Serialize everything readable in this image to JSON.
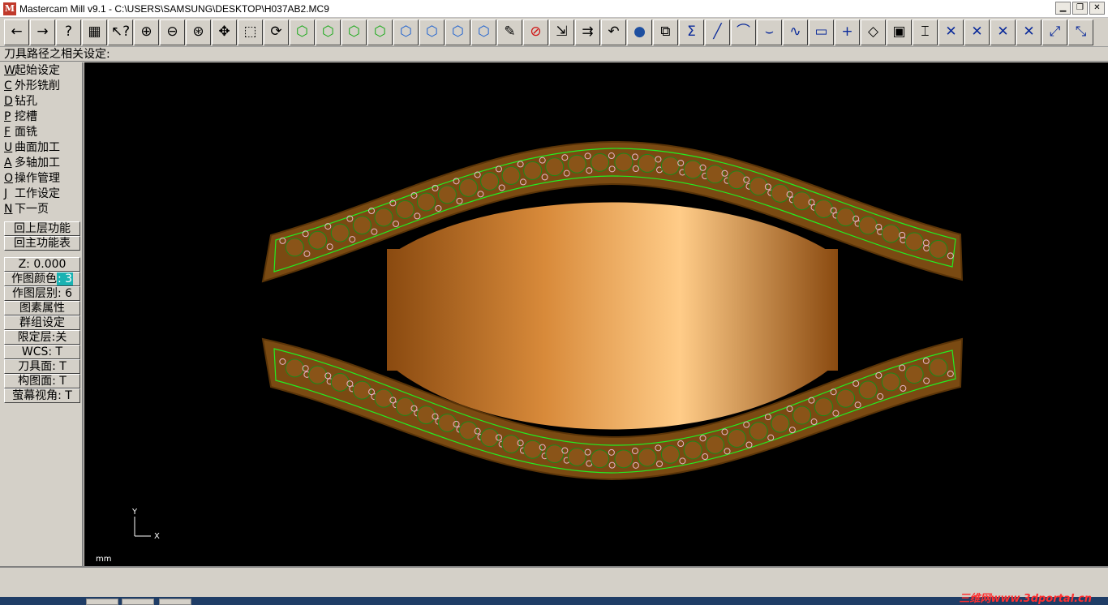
{
  "window": {
    "title": "Mastercam Mill v9.1 - C:\\USERS\\SAMSUNG\\DESKTOP\\H037AB2.MC9",
    "app_icon": "mastercam-logo-icon",
    "minimize_label": "▁",
    "restore_label": "❐",
    "close_label": "✕"
  },
  "toolbar": {
    "buttons": [
      {
        "name": "back-icon",
        "glyph": "←"
      },
      {
        "name": "forward-icon",
        "glyph": "→"
      },
      {
        "name": "help-icon",
        "glyph": "?"
      },
      {
        "name": "calculator-icon",
        "glyph": "▦"
      },
      {
        "name": "analyze-icon",
        "glyph": "↖?"
      },
      {
        "name": "zoom-window-icon",
        "glyph": "⊕"
      },
      {
        "name": "zoom-out-icon",
        "glyph": "⊖"
      },
      {
        "name": "zoom-fit-icon",
        "glyph": "⊛"
      },
      {
        "name": "pan-icon",
        "glyph": "✥"
      },
      {
        "name": "zoom-select-icon",
        "glyph": "⬚"
      },
      {
        "name": "dynamic-rotate-icon",
        "glyph": "⟳"
      },
      {
        "name": "view-top-cube-icon",
        "glyph": "⬡"
      },
      {
        "name": "view-front-cube-icon",
        "glyph": "⬡"
      },
      {
        "name": "view-side-cube-icon",
        "glyph": "⬡"
      },
      {
        "name": "view-iso-cube-icon",
        "glyph": "⬡"
      },
      {
        "name": "view-cube-blue-1-icon",
        "glyph": "⬡"
      },
      {
        "name": "view-cube-blue-2-icon",
        "glyph": "⬡"
      },
      {
        "name": "view-cube-blue-3-icon",
        "glyph": "⬡"
      },
      {
        "name": "view-cube-blue-4-icon",
        "glyph": "⬡"
      },
      {
        "name": "pencil-icon",
        "glyph": "✎"
      },
      {
        "name": "no-delete-icon",
        "glyph": "⊘"
      },
      {
        "name": "move-icon",
        "glyph": "⇲"
      },
      {
        "name": "copy-icon",
        "glyph": "⇉"
      },
      {
        "name": "undo-icon",
        "glyph": "↶"
      },
      {
        "name": "sphere-icon",
        "glyph": "●"
      },
      {
        "name": "transform-icon",
        "glyph": "⧉"
      },
      {
        "name": "sum-icon",
        "glyph": "Σ"
      },
      {
        "name": "line-icon",
        "glyph": "╱"
      },
      {
        "name": "arc-icon",
        "glyph": "⌒"
      },
      {
        "name": "fillet-icon",
        "glyph": "⌣"
      },
      {
        "name": "spline-icon",
        "glyph": "∿"
      },
      {
        "name": "rectangle-icon",
        "glyph": "▭"
      },
      {
        "name": "point-icon",
        "glyph": "+"
      },
      {
        "name": "surface-icon",
        "glyph": "◇"
      },
      {
        "name": "solid-box-icon",
        "glyph": "▣"
      },
      {
        "name": "toolpath-icon",
        "glyph": "⌶"
      },
      {
        "name": "trim-1-icon",
        "glyph": "✕"
      },
      {
        "name": "trim-2-icon",
        "glyph": "✕"
      },
      {
        "name": "trim-3-icon",
        "glyph": "✕"
      },
      {
        "name": "trim-4-icon",
        "glyph": "✕"
      },
      {
        "name": "extend-icon",
        "glyph": "⤢"
      },
      {
        "name": "break-icon",
        "glyph": "⤡"
      }
    ]
  },
  "prompt": {
    "text": "刀具路径之相关设定:"
  },
  "menu": {
    "items": [
      {
        "key": "W",
        "label": "起始设定"
      },
      {
        "key": "C",
        "label": "外形铣削"
      },
      {
        "key": "D",
        "label": "钻孔"
      },
      {
        "key": "P",
        "label": "挖槽"
      },
      {
        "key": "F",
        "label": "面铣"
      },
      {
        "key": "U",
        "label": "曲面加工"
      },
      {
        "key": "A",
        "label": "多轴加工"
      },
      {
        "key": "O",
        "label": "操作管理"
      },
      {
        "key": "J",
        "label": "工作设定"
      },
      {
        "key": "N",
        "label": "下一页"
      }
    ],
    "nav": {
      "back_label": "回上层功能",
      "main_label": "回主功能表"
    }
  },
  "panel": {
    "z_label": "Z:  0.000",
    "color_label": "作图颜色",
    "color_value": ": 3",
    "level_label": "作图层别:  6",
    "attributes_label": "图素属性",
    "group_label": "群组设定",
    "mask_label": "限定层:关",
    "wcs_label": "WCS:   T",
    "tplane_label": "刀具面: T",
    "cplane_label": "构图面: T",
    "gview_label": "萤幕视角: T"
  },
  "viewport": {
    "axis_y": "Y",
    "axis_x": "X",
    "units": "mm",
    "colors": {
      "background": "#000000",
      "band": "#7a4a12",
      "toolpath": "#22ee22",
      "copper_light": "#ffcc88",
      "copper_dark": "#8a4a10",
      "hole": "#e8b4c8"
    }
  },
  "watermark": {
    "text": "三维网www.3dportal.cn"
  }
}
